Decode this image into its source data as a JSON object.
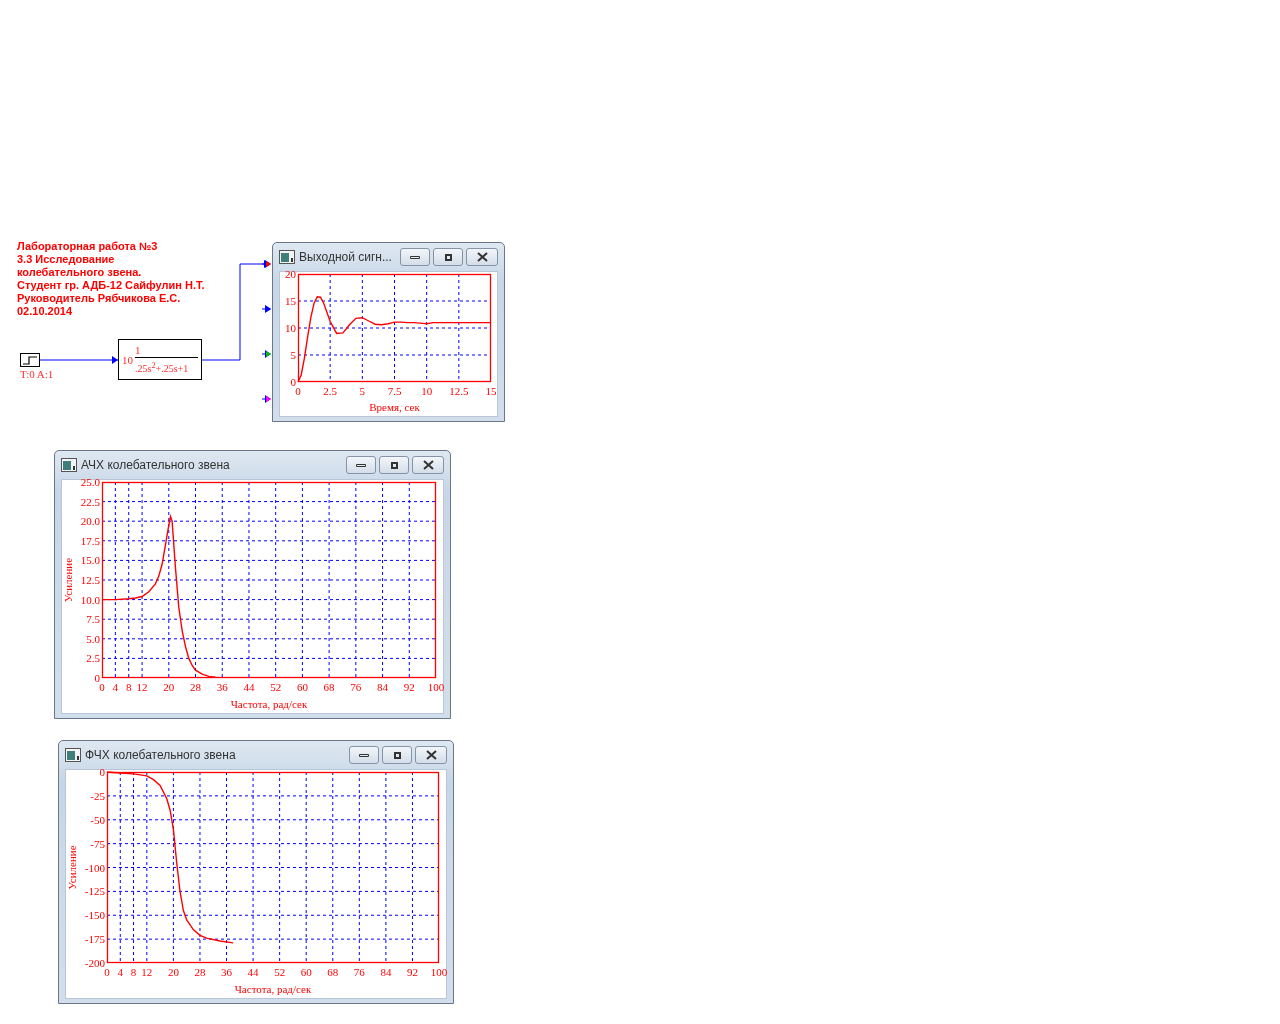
{
  "annotation": {
    "lines": [
      "Лабораторная работа №3",
      "3.3 Исследование",
      "колебательного звена.",
      "Студент гр. АДБ-12 Сайфулин Н.Т.",
      "Руководитель Рябчикова Е.С.",
      "02.10.2014"
    ]
  },
  "blocks": [
    {
      "kind": "step",
      "label": "T:0 A:1"
    },
    {
      "kind": "transfer",
      "gain": "10",
      "numerator": "1",
      "denominator": ".25s$^{2}$+.25s+1"
    }
  ],
  "scope_inputs": [
    {
      "color": "#ff0000"
    },
    {
      "color": "#0000ff"
    },
    {
      "color": "#00c000"
    },
    {
      "color": "#ff00ff"
    }
  ],
  "windows": [
    {
      "title": "Выходной сигн...",
      "chart_data": {
        "type": "line",
        "grid": true,
        "xlabel": "Время, сек",
        "xlim": [
          0,
          15
        ],
        "ylim": [
          0,
          20
        ],
        "xticks": [
          0,
          2.5,
          5,
          7.5,
          10,
          12.5,
          15
        ],
        "yticks": [
          0,
          5,
          10,
          15,
          20
        ],
        "x": [
          0,
          0.25,
          0.5,
          0.75,
          1,
          1.25,
          1.5,
          1.75,
          2,
          2.5,
          3,
          3.5,
          4,
          4.5,
          5,
          5.5,
          6,
          6.5,
          7,
          7.5,
          8,
          8.5,
          9,
          9.5,
          10,
          10.5,
          11,
          12,
          13,
          14,
          15
        ],
        "series": [
          {
            "color": "#ff0000",
            "values": [
              0,
              1.3,
              4.4,
              8.3,
              12,
              14.6,
              15.8,
              15.7,
              14.6,
              11.2,
              9,
              9.1,
              10.6,
              11.8,
              11.9,
              11.3,
              10.7,
              10.6,
              10.8,
              11.1,
              11.1,
              11,
              11,
              10.9,
              10.8,
              11,
              11,
              11,
              11,
              11,
              11
            ]
          }
        ]
      }
    },
    {
      "title": "АЧХ колебательного звена",
      "chart_data": {
        "type": "line",
        "grid": true,
        "xlabel": "Частота, рад/сек",
        "ylabel": "Усиление",
        "xlim": [
          0,
          100
        ],
        "ylim": [
          0,
          25
        ],
        "xticks": [
          0,
          4,
          8,
          12,
          20,
          28,
          36,
          44,
          52,
          60,
          68,
          76,
          84,
          92,
          100
        ],
        "yticks": [
          0,
          2.5,
          {
            "value": 5,
            "label": "5.0"
          },
          7.5,
          {
            "value": 10,
            "label": "10.0"
          },
          12.5,
          {
            "value": 15,
            "label": "15.0"
          },
          17.5,
          {
            "value": 20,
            "label": "20.0"
          },
          22.5,
          {
            "value": 25,
            "label": "25.0"
          }
        ],
        "x": [
          0,
          4,
          8,
          10,
          12,
          14,
          16,
          17,
          18,
          19,
          20,
          20.5,
          21,
          22,
          23,
          24,
          25,
          26,
          27,
          28,
          30,
          32,
          34
        ],
        "series": [
          {
            "color": "#ff0000",
            "values": [
              10,
              10,
              10.1,
              10.2,
              10.4,
              11,
              12,
              13,
              14.5,
              17,
              19.5,
              20.6,
              20,
              14,
              9,
              6,
              4,
              2.5,
              1.6,
              1,
              0.5,
              0.2,
              0.1
            ]
          }
        ]
      }
    },
    {
      "title": "ФЧХ колебательного звена",
      "chart_data": {
        "type": "line",
        "grid": true,
        "xlabel": "Частота, рад/сек",
        "ylabel": "Усиление",
        "xlim": [
          0,
          100
        ],
        "ylim": [
          -200,
          0
        ],
        "xticks": [
          0,
          4,
          8,
          12,
          20,
          28,
          36,
          44,
          52,
          60,
          68,
          76,
          84,
          92,
          100
        ],
        "yticks": [
          0,
          -25,
          -50,
          -75,
          -100,
          -125,
          -150,
          -175,
          -200
        ],
        "x": [
          0,
          4,
          8,
          12,
          14,
          16,
          18,
          19,
          20,
          21,
          22,
          23,
          24,
          26,
          28,
          30,
          34,
          38
        ],
        "series": [
          {
            "color": "#ff0000",
            "values": [
              0,
              -1,
              -2,
              -4,
              -8,
              -14,
              -28,
              -40,
              -60,
              -95,
              -125,
              -145,
              -155,
              -165,
              -171,
              -174,
              -177,
              -179
            ]
          }
        ]
      }
    }
  ]
}
